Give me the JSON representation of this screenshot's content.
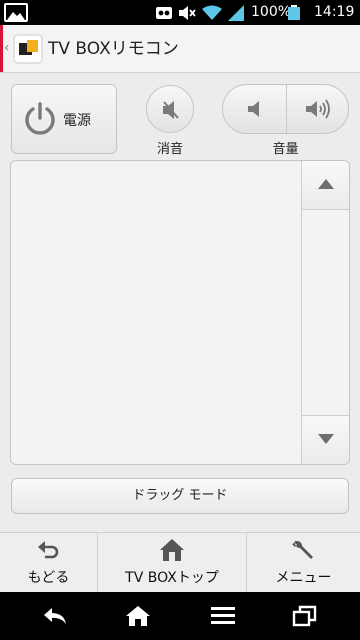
{
  "status_bar": {
    "battery_text": "100%",
    "time": "14:19",
    "icons": [
      "image-thumbnail-icon",
      "voicemail-icon",
      "mute-icon",
      "wifi-icon",
      "signal-icon",
      "battery-icon"
    ]
  },
  "title_bar": {
    "back_chevron": "‹",
    "app_icon": "tv-box-app-icon",
    "title": "TV BOXリモコン",
    "accent_color": "#d8143a"
  },
  "controls": {
    "power_label": "電源",
    "mute_label": "消音",
    "volume_label": "音量"
  },
  "touchpad": {
    "scroll_up_icon": "triangle-up-icon",
    "scroll_down_icon": "triangle-down-icon"
  },
  "drag_mode_label": "ドラッグ モード",
  "bottom_tabs": [
    {
      "label": "もどる",
      "icon": "back-arrow-icon"
    },
    {
      "label": "TV BOXトップ",
      "icon": "home-icon"
    },
    {
      "label": "メニュー",
      "icon": "wrench-icon"
    }
  ],
  "nav_bar": {
    "icons": [
      "nav-back-icon",
      "nav-home-icon",
      "nav-menu-icon",
      "nav-recents-icon"
    ]
  }
}
